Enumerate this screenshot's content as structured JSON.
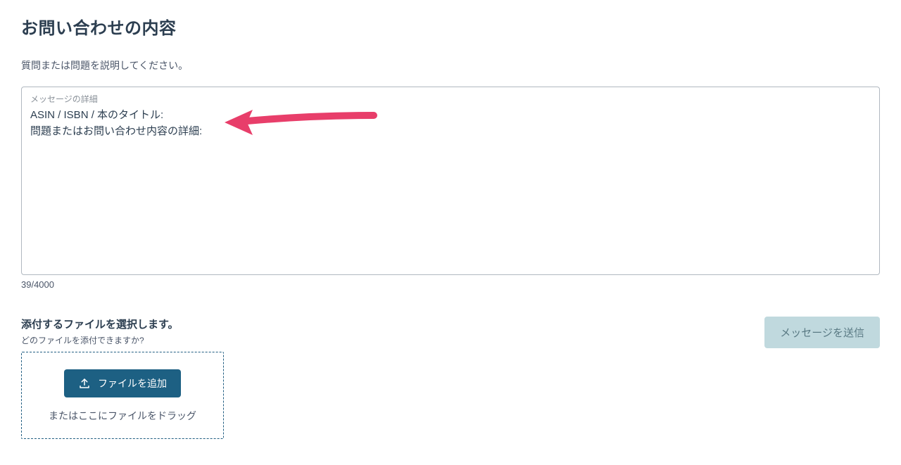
{
  "page": {
    "title": "お問い合わせの内容",
    "instruction": "質問または問題を説明してください。"
  },
  "message_box": {
    "label": "メッセージの詳細",
    "content": "ASIN / ISBN / 本のタイトル:\n問題またはお問い合わせ内容の詳細:",
    "counter": "39/4000"
  },
  "attachment": {
    "title": "添付するファイルを選択します。",
    "hint": "どのファイルを添付できますか?",
    "add_button": "ファイルを追加",
    "drag_text": "またはここにファイルをドラッグ"
  },
  "actions": {
    "send_button": "メッセージを送信"
  },
  "annotation": {
    "arrow_color": "#e83e6a"
  }
}
